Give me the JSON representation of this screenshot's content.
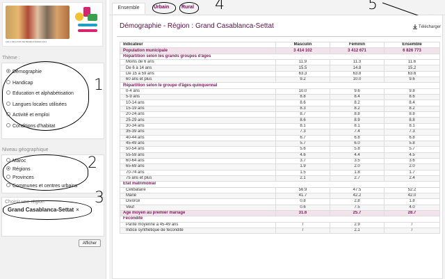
{
  "sidebar": {
    "logo_tagline": "LES 1 MILLIONS DE BÉNÉFICIAIRES 2014",
    "theme_title": "Thème :",
    "themes": [
      {
        "label": "Démographie",
        "selected": true
      },
      {
        "label": "Handicap",
        "selected": false
      },
      {
        "label": "Education et alphabétisation",
        "selected": false
      },
      {
        "label": "Langues locales utilisées",
        "selected": false
      },
      {
        "label": "Activité et emploi",
        "selected": false
      },
      {
        "label": "Conditions d'habitat",
        "selected": false
      }
    ],
    "geo_title": "Niveau géographique",
    "geo_levels": [
      {
        "label": "Maroc",
        "selected": false
      },
      {
        "label": "Régions",
        "selected": true
      },
      {
        "label": "Provinces",
        "selected": false
      },
      {
        "label": "Communes et centres urbains",
        "selected": false
      }
    ],
    "region_title": "Choisir une région",
    "region_value": "Grand Casablanca-Settat",
    "region_remove": "×",
    "submit_label": "Afficher",
    "annotations": [
      "1",
      "2",
      "3"
    ]
  },
  "main": {
    "tabs": {
      "ensemble": "Ensemble",
      "urbain": "Urbain",
      "rural": "Rural"
    },
    "annotations": {
      "tabs": "4",
      "download": "5"
    },
    "title": "Démographie - Région : Grand Casablanca-Settat",
    "download_label": "Télécharger",
    "download_icon": "download-icon",
    "columns": [
      "Indicateur",
      "Masculin",
      "Féminin",
      "Ensemble"
    ],
    "rows": [
      {
        "type": "hl",
        "label": "Population municipale",
        "m": "3 414 102",
        "f": "3 412 671",
        "e": "6 826 773"
      },
      {
        "type": "sec",
        "label": "Répartition selon les grands groupes d'âges"
      },
      {
        "type": "row",
        "label": "Moins de 6 ans",
        "m": "11.9",
        "f": "11.3",
        "e": "11.6"
      },
      {
        "type": "row",
        "label": "De 6 à 14 ans",
        "m": "15.5",
        "f": "14.8",
        "e": "15.2"
      },
      {
        "type": "row",
        "label": "De 15 à 59 ans",
        "m": "63.3",
        "f": "63.8",
        "e": "63.6"
      },
      {
        "type": "row",
        "label": "60 ans et plus",
        "m": "9.2",
        "f": "10.0",
        "e": "9.6"
      },
      {
        "type": "sec",
        "label": "Répartition selon le groupe d'âges quinquennal"
      },
      {
        "type": "row",
        "label": "0-4 ans",
        "m": "10.0",
        "f": "9.6",
        "e": "9.8"
      },
      {
        "type": "row",
        "label": "5-9 ans",
        "m": "8.8",
        "f": "8.4",
        "e": "8.6"
      },
      {
        "type": "row",
        "label": "10-14 ans",
        "m": "8.6",
        "f": "8.2",
        "e": "8.4"
      },
      {
        "type": "row",
        "label": "15-19 ans",
        "m": "8.3",
        "f": "8.2",
        "e": "8.2"
      },
      {
        "type": "row",
        "label": "20-24 ans",
        "m": "8.7",
        "f": "8.8",
        "e": "8.8"
      },
      {
        "type": "row",
        "label": "25-29 ans",
        "m": "8.6",
        "f": "8.9",
        "e": "8.8"
      },
      {
        "type": "row",
        "label": "30-34 ans",
        "m": "8.1",
        "f": "8.1",
        "e": "8.1"
      },
      {
        "type": "row",
        "label": "35-39 ans",
        "m": "7.3",
        "f": "7.4",
        "e": "7.3"
      },
      {
        "type": "row",
        "label": "40-44 ans",
        "m": "6.7",
        "f": "6.8",
        "e": "6.8"
      },
      {
        "type": "row",
        "label": "45-49 ans",
        "m": "5.7",
        "f": "6.0",
        "e": "5.8"
      },
      {
        "type": "row",
        "label": "50-54 ans",
        "m": "5.6",
        "f": "5.8",
        "e": "5.7"
      },
      {
        "type": "row",
        "label": "55-59 ans",
        "m": "4.6",
        "f": "4.4",
        "e": "4.5"
      },
      {
        "type": "row",
        "label": "60-64 ans",
        "m": "3.7",
        "f": "3.5",
        "e": "3.6"
      },
      {
        "type": "row",
        "label": "65-69 ans",
        "m": "1.9",
        "f": "2.0",
        "e": "2.0"
      },
      {
        "type": "row",
        "label": "70-74 ans",
        "m": "1.5",
        "f": "1.8",
        "e": "1.7"
      },
      {
        "type": "row",
        "label": "75 ans et plus",
        "m": "2.1",
        "f": "2.7",
        "e": "2.4"
      },
      {
        "type": "sec",
        "label": "État matrimonial"
      },
      {
        "type": "row",
        "label": "Célibataire",
        "m": "56.9",
        "f": "47.5",
        "e": "52.2"
      },
      {
        "type": "row",
        "label": "Marié",
        "m": "41.7",
        "f": "42.2",
        "e": "42.0"
      },
      {
        "type": "row",
        "label": "Divorcé",
        "m": "0.8",
        "f": "2.8",
        "e": "1.8"
      },
      {
        "type": "row",
        "label": "Veuf",
        "m": "0.6",
        "f": "7.5",
        "e": "4.0"
      },
      {
        "type": "hl",
        "label": "Âge moyen au premier mariage",
        "m": "31.6",
        "f": "25.7",
        "e": "28.7"
      },
      {
        "type": "sec",
        "label": "Fécondité"
      },
      {
        "type": "row",
        "label": "Parité moyenne à 45-49 ans",
        "m": "/",
        "f": "2.9",
        "e": "/"
      },
      {
        "type": "row",
        "label": "Indice synthétique de fécondité",
        "m": "/",
        "f": "2.1",
        "e": "/"
      }
    ]
  }
}
